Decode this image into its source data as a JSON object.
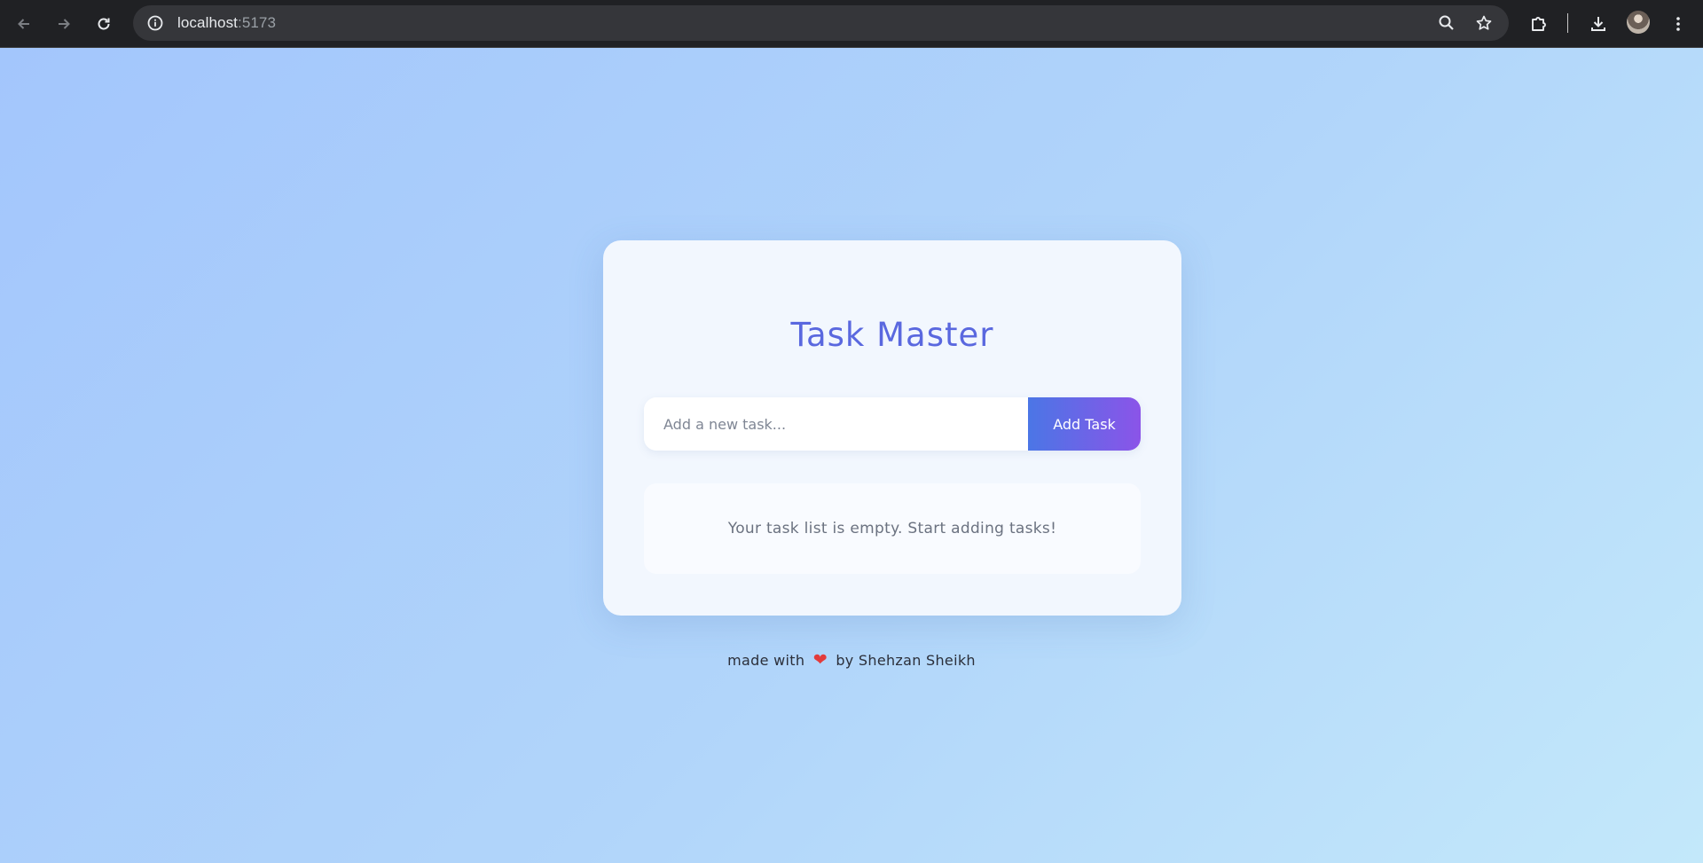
{
  "browser": {
    "url_host": "localhost",
    "url_port": ":5173",
    "icons": {
      "back": "arrow-left-icon",
      "forward": "arrow-right-icon",
      "reload": "reload-icon",
      "site_info": "info-circle-icon",
      "zoom": "magnifier-icon",
      "bookmark": "star-icon",
      "extensions": "puzzle-icon",
      "downloads": "download-icon",
      "menu": "kebab-menu-icon"
    }
  },
  "app": {
    "title": "Task Master",
    "input_placeholder": "Add a new task...",
    "add_button_label": "Add Task",
    "empty_message": "Your task list is empty. Start adding tasks!",
    "tasks": []
  },
  "footer": {
    "prefix": "made with",
    "heart": "❤",
    "suffix": "by Shehzan Sheikh"
  },
  "colors": {
    "title": "#5a68df",
    "button_gradient_start": "#4b76e6",
    "button_gradient_end": "#8b54e8",
    "heart": "#e33b3b",
    "page_bg_start": "#a3c6fc",
    "page_bg_end": "#c3e8fa"
  }
}
